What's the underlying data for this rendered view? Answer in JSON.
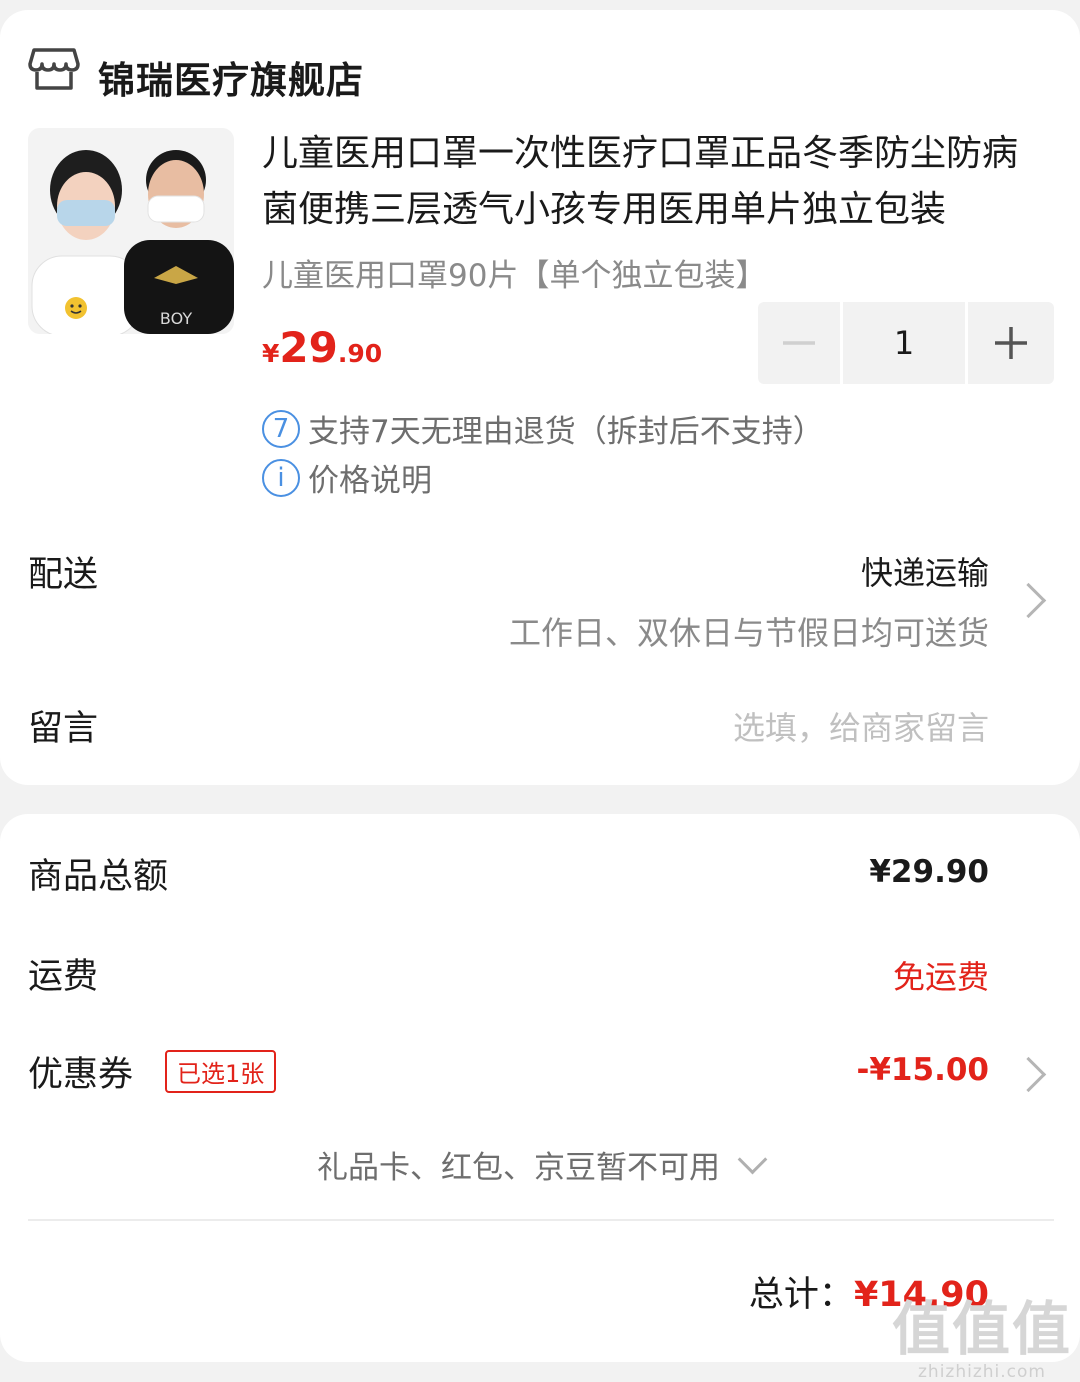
{
  "shop": {
    "name": "锦瑞医疗旗舰店",
    "icon": "store-icon"
  },
  "product": {
    "title": "儿童医用口罩一次性医疗口罩正品冬季防尘防病菌便携三层透气小孩专用医用单片独立包装",
    "spec": "儿童医用口罩90片【单个独立包装】",
    "price": {
      "currency": "¥",
      "integer": "29",
      "decimal": ".90"
    },
    "quantity": "1",
    "image_desc_labels": {
      "shirt_text": "BOY"
    }
  },
  "services": [
    {
      "icon_text": "7",
      "text": "支持7天无理由退货（拆封后不支持）"
    },
    {
      "icon_text": "i",
      "text": "价格说明"
    }
  ],
  "delivery": {
    "label": "配送",
    "method": "快递运输",
    "detail": "工作日、双休日与节假日均可送货"
  },
  "message": {
    "label": "留言",
    "placeholder": "选填，给商家留言"
  },
  "summary": {
    "goods_total_label": "商品总额",
    "goods_total": "¥29.90",
    "shipping_label": "运费",
    "shipping": "免运费",
    "coupon_label": "优惠券",
    "coupon_tag": "已选1张",
    "coupon_value": "-¥15.00",
    "unavailable": "礼品卡、红包、京豆暂不可用",
    "total_label": "总计：",
    "total": "¥14.90"
  },
  "watermark": {
    "big": "值值值",
    "small": "zhizhizhi.com"
  },
  "colors": {
    "accent": "#e2231a",
    "info": "#4a90e2"
  }
}
